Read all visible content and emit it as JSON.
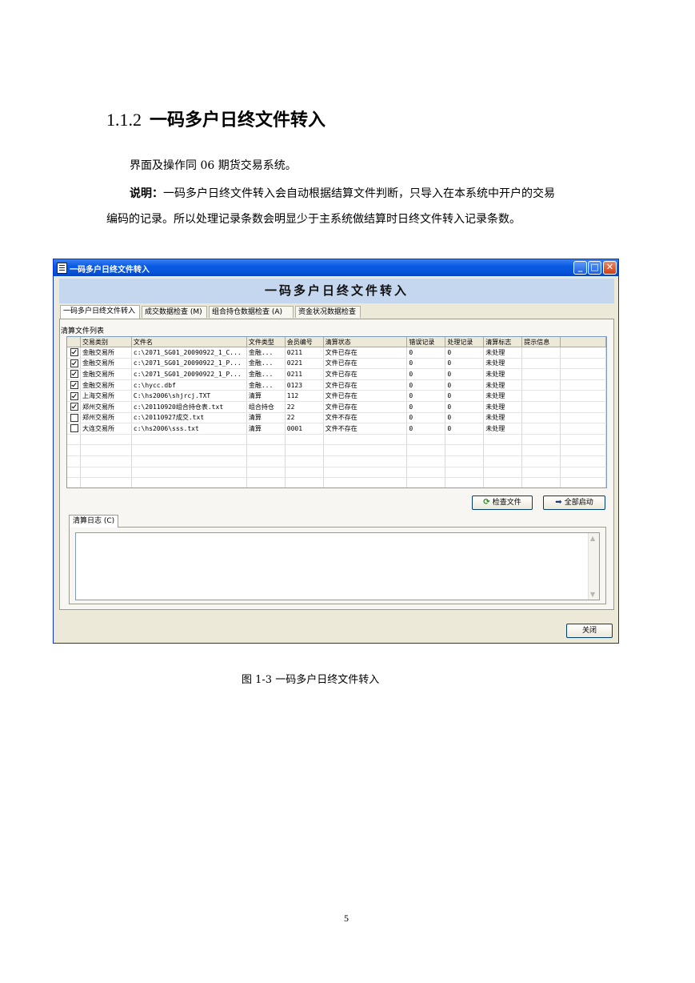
{
  "doc": {
    "heading_number": "1.1.2",
    "heading_text": "一码多户日终文件转入",
    "para1": "界面及操作同 06 期货交易系统。",
    "para2_bold": "说明：",
    "para2_rest": "一码多户日终文件转入会自动根据结算文件判断，只导入在本系统中开户的交易",
    "para2_line2": "编码的记录。所以处理记录条数会明显少于主系统做结算时日终文件转入记录条数。",
    "caption": "图 1-3  一码多户日终文件转入",
    "page_number": "5"
  },
  "window": {
    "title": "一码多户日终文件转入",
    "banner": "一码多户日终文件转入",
    "tabs": [
      "一码多户日终文件转入",
      "成交数据检查 (M)",
      "组合持仓数据检查 (A)",
      "资金状况数据检查"
    ],
    "group_label": "清算文件列表",
    "columns": [
      "",
      "交易类别",
      "文件名",
      "文件类型",
      "会员编号",
      "清算状态",
      "错误记录",
      "处理记录",
      "清算标志",
      "提示信息"
    ],
    "rows": [
      {
        "checked": true,
        "exchange": "金融交易所",
        "file": "c:\\2071_SG01_20090922_1_C...",
        "type": "金融...",
        "member": "0211",
        "status": "文件已存在",
        "errors": "0",
        "processed": "0",
        "flag": "未处理",
        "info": ""
      },
      {
        "checked": true,
        "exchange": "金融交易所",
        "file": "c:\\2071_SG01_20090922_1_P...",
        "type": "金融...",
        "member": "0221",
        "status": "文件已存在",
        "errors": "0",
        "processed": "0",
        "flag": "未处理",
        "info": ""
      },
      {
        "checked": true,
        "exchange": "金融交易所",
        "file": "c:\\2071_SG01_20090922_1_P...",
        "type": "金融...",
        "member": "0211",
        "status": "文件已存在",
        "errors": "0",
        "processed": "0",
        "flag": "未处理",
        "info": ""
      },
      {
        "checked": true,
        "exchange": "金融交易所",
        "file": "c:\\hycc.dbf",
        "type": "金融...",
        "member": "0123",
        "status": "文件已存在",
        "errors": "0",
        "processed": "0",
        "flag": "未处理",
        "info": ""
      },
      {
        "checked": true,
        "exchange": "上海交易所",
        "file": "C:\\hs2006\\shjrcj.TXT",
        "type": "清算",
        "member": "112",
        "status": "文件已存在",
        "errors": "0",
        "processed": "0",
        "flag": "未处理",
        "info": ""
      },
      {
        "checked": true,
        "exchange": "郑州交易所",
        "file": "c:\\20110920组合持仓表.txt",
        "type": "组合持仓",
        "member": "22",
        "status": "文件已存在",
        "errors": "0",
        "processed": "0",
        "flag": "未处理",
        "info": ""
      },
      {
        "checked": false,
        "exchange": "郑州交易所",
        "file": "c:\\20110927成交.txt",
        "type": "清算",
        "member": "22",
        "status": "文件不存在",
        "errors": "0",
        "processed": "0",
        "flag": "未处理",
        "info": ""
      },
      {
        "checked": false,
        "exchange": "大连交易所",
        "file": "c:\\hs2006\\sss.txt",
        "type": "清算",
        "member": "0001",
        "status": "文件不存在",
        "errors": "0",
        "processed": "0",
        "flag": "未处理",
        "info": ""
      }
    ],
    "check_button": "检查文件",
    "start_button": "全部启动",
    "log_tab": "清算日志 (C)",
    "close_button": "关闭"
  }
}
